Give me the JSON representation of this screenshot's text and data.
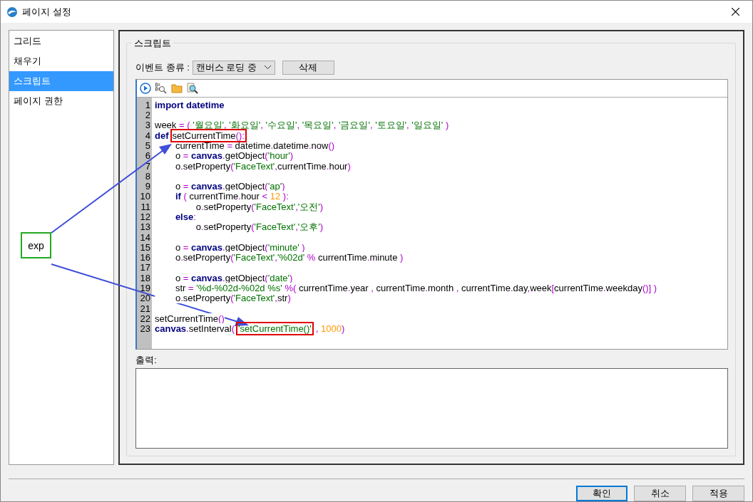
{
  "window": {
    "title": "페이지 설정"
  },
  "sidebar": {
    "items": [
      {
        "label": "그리드",
        "selected": false
      },
      {
        "label": "채우기",
        "selected": false
      },
      {
        "label": "스크립트",
        "selected": true
      },
      {
        "label": "페이지 권한",
        "selected": false
      }
    ]
  },
  "script_group": {
    "title": "스크립트",
    "event_label": "이벤트 종류 :",
    "event_select": {
      "value": "캔버스 로딩 중"
    },
    "delete_button": "삭제"
  },
  "editor": {
    "lines": [
      {
        "number": "1",
        "tokens": [
          {
            "kind": "kw",
            "text": "import datetime"
          }
        ]
      },
      {
        "number": "2"
      },
      {
        "number": "3",
        "tokens": [
          {
            "kind": "id",
            "text": "week "
          },
          {
            "kind": "op",
            "text": "= ( "
          },
          {
            "kind": "str",
            "text": "'월요일'"
          },
          {
            "kind": "op",
            "text": ", "
          },
          {
            "kind": "str",
            "text": "'화요일'"
          },
          {
            "kind": "op",
            "text": ", "
          },
          {
            "kind": "str",
            "text": "'수요일'"
          },
          {
            "kind": "op",
            "text": ", "
          },
          {
            "kind": "str",
            "text": "'목요일'"
          },
          {
            "kind": "op",
            "text": ", "
          },
          {
            "kind": "str",
            "text": "'금요일'"
          },
          {
            "kind": "op",
            "text": ", "
          },
          {
            "kind": "str",
            "text": "'토요일'"
          },
          {
            "kind": "op",
            "text": ", "
          },
          {
            "kind": "str",
            "text": "'일요일'"
          },
          {
            "kind": "op",
            "text": " )"
          }
        ]
      },
      {
        "number": "4",
        "tokens": [
          {
            "kind": "kw",
            "text": "def"
          },
          {
            "kind": "id",
            "text": "setCurrentTime",
            "boxed": true
          },
          {
            "kind": "op",
            "text": "():",
            "boxed": true
          }
        ]
      },
      {
        "number": "5",
        "tokens": [
          {
            "kind": "id",
            "text": "        currentTime "
          },
          {
            "kind": "op",
            "text": "= "
          },
          {
            "kind": "id",
            "text": "datetime"
          },
          {
            "kind": "op",
            "text": "."
          },
          {
            "kind": "id",
            "text": "datetime"
          },
          {
            "kind": "op",
            "text": "."
          },
          {
            "kind": "id",
            "text": "now"
          },
          {
            "kind": "op",
            "text": "()"
          }
        ]
      },
      {
        "number": "6",
        "tokens": [
          {
            "kind": "id",
            "text": "        o "
          },
          {
            "kind": "op",
            "text": "= "
          },
          {
            "kind": "kw",
            "text": "canvas"
          },
          {
            "kind": "op",
            "text": "."
          },
          {
            "kind": "id",
            "text": "getObject"
          },
          {
            "kind": "op",
            "text": "("
          },
          {
            "kind": "str",
            "text": "'hour'"
          },
          {
            "kind": "op",
            "text": ")"
          }
        ]
      },
      {
        "number": "7",
        "tokens": [
          {
            "kind": "id",
            "text": "        o"
          },
          {
            "kind": "op",
            "text": "."
          },
          {
            "kind": "id",
            "text": "setProperty"
          },
          {
            "kind": "op",
            "text": "("
          },
          {
            "kind": "str",
            "text": "'FaceText'"
          },
          {
            "kind": "op",
            "text": ","
          },
          {
            "kind": "id",
            "text": "currentTime"
          },
          {
            "kind": "op",
            "text": "."
          },
          {
            "kind": "id",
            "text": "hour"
          },
          {
            "kind": "op",
            "text": ")"
          }
        ]
      },
      {
        "number": "8"
      },
      {
        "number": "9",
        "tokens": [
          {
            "kind": "id",
            "text": "        o "
          },
          {
            "kind": "op",
            "text": "= "
          },
          {
            "kind": "kw",
            "text": "canvas"
          },
          {
            "kind": "op",
            "text": "."
          },
          {
            "kind": "id",
            "text": "getObject"
          },
          {
            "kind": "op",
            "text": "("
          },
          {
            "kind": "str",
            "text": "'ap'"
          },
          {
            "kind": "op",
            "text": ")"
          }
        ]
      },
      {
        "number": "10",
        "tokens": [
          {
            "kind": "kw",
            "text": "        if"
          },
          {
            "kind": "op",
            "text": " ( "
          },
          {
            "kind": "id",
            "text": "currentTime"
          },
          {
            "kind": "op",
            "text": "."
          },
          {
            "kind": "id",
            "text": "hour "
          },
          {
            "kind": "op",
            "text": "< "
          },
          {
            "kind": "num",
            "text": "12"
          },
          {
            "kind": "op",
            "text": " ):"
          }
        ]
      },
      {
        "number": "11",
        "tokens": [
          {
            "kind": "id",
            "text": "                o"
          },
          {
            "kind": "op",
            "text": "."
          },
          {
            "kind": "id",
            "text": "setProperty"
          },
          {
            "kind": "op",
            "text": "("
          },
          {
            "kind": "str",
            "text": "'FaceText'"
          },
          {
            "kind": "op",
            "text": ","
          },
          {
            "kind": "str",
            "text": "'오전'"
          },
          {
            "kind": "op",
            "text": ")"
          }
        ]
      },
      {
        "number": "12",
        "tokens": [
          {
            "kind": "kw",
            "text": "        else"
          },
          {
            "kind": "op",
            "text": ":"
          }
        ]
      },
      {
        "number": "13",
        "tokens": [
          {
            "kind": "id",
            "text": "                o"
          },
          {
            "kind": "op",
            "text": "."
          },
          {
            "kind": "id",
            "text": "setProperty"
          },
          {
            "kind": "op",
            "text": "("
          },
          {
            "kind": "str",
            "text": "'FaceText'"
          },
          {
            "kind": "op",
            "text": ","
          },
          {
            "kind": "str",
            "text": "'오후'"
          },
          {
            "kind": "op",
            "text": ")"
          }
        ]
      },
      {
        "number": "14"
      },
      {
        "number": "15",
        "tokens": [
          {
            "kind": "id",
            "text": "        o "
          },
          {
            "kind": "op",
            "text": "= "
          },
          {
            "kind": "kw",
            "text": "canvas"
          },
          {
            "kind": "op",
            "text": "."
          },
          {
            "kind": "id",
            "text": "getObject"
          },
          {
            "kind": "op",
            "text": "("
          },
          {
            "kind": "str",
            "text": "'minute' "
          },
          {
            "kind": "op",
            "text": ")"
          }
        ]
      },
      {
        "number": "16",
        "tokens": [
          {
            "kind": "id",
            "text": "        o"
          },
          {
            "kind": "op",
            "text": "."
          },
          {
            "kind": "id",
            "text": "setProperty"
          },
          {
            "kind": "op",
            "text": "("
          },
          {
            "kind": "str",
            "text": "'FaceText'"
          },
          {
            "kind": "op",
            "text": ","
          },
          {
            "kind": "str",
            "text": "'%02d' "
          },
          {
            "kind": "op",
            "text": "% "
          },
          {
            "kind": "id",
            "text": "currentTime"
          },
          {
            "kind": "op",
            "text": "."
          },
          {
            "kind": "id",
            "text": "minute "
          },
          {
            "kind": "op",
            "text": ")"
          }
        ]
      },
      {
        "number": "17"
      },
      {
        "number": "18",
        "tokens": [
          {
            "kind": "id",
            "text": "        o "
          },
          {
            "kind": "op",
            "text": "= "
          },
          {
            "kind": "kw",
            "text": "canvas"
          },
          {
            "kind": "op",
            "text": "."
          },
          {
            "kind": "id",
            "text": "getObject"
          },
          {
            "kind": "op",
            "text": "("
          },
          {
            "kind": "str",
            "text": "'date'"
          },
          {
            "kind": "op",
            "text": ")"
          }
        ]
      },
      {
        "number": "19",
        "tokens": [
          {
            "kind": "id",
            "text": "        str "
          },
          {
            "kind": "op",
            "text": "= "
          },
          {
            "kind": "str",
            "text": "'%d-%02d-%02d %s' "
          },
          {
            "kind": "op",
            "text": "%( "
          },
          {
            "kind": "id",
            "text": "currentTime"
          },
          {
            "kind": "op",
            "text": "."
          },
          {
            "kind": "id",
            "text": "year "
          },
          {
            "kind": "op",
            "text": ", "
          },
          {
            "kind": "id",
            "text": "currentTime"
          },
          {
            "kind": "op",
            "text": "."
          },
          {
            "kind": "id",
            "text": "month "
          },
          {
            "kind": "op",
            "text": ", "
          },
          {
            "kind": "id",
            "text": "currentTime"
          },
          {
            "kind": "op",
            "text": "."
          },
          {
            "kind": "id",
            "text": "day"
          },
          {
            "kind": "op",
            "text": ","
          },
          {
            "kind": "id",
            "text": "week"
          },
          {
            "kind": "op",
            "text": "["
          },
          {
            "kind": "id",
            "text": "currentTime"
          },
          {
            "kind": "op",
            "text": "."
          },
          {
            "kind": "id",
            "text": "weekday"
          },
          {
            "kind": "op",
            "text": "()] )"
          }
        ]
      },
      {
        "number": "20",
        "tokens": [
          {
            "kind": "id",
            "text": "        o"
          },
          {
            "kind": "op",
            "text": "."
          },
          {
            "kind": "id",
            "text": "setProperty"
          },
          {
            "kind": "op",
            "text": "("
          },
          {
            "kind": "str",
            "text": "'FaceText'"
          },
          {
            "kind": "op",
            "text": ","
          },
          {
            "kind": "id",
            "text": "str"
          },
          {
            "kind": "op",
            "text": ")"
          }
        ]
      },
      {
        "number": "21"
      },
      {
        "number": "22",
        "tokens": [
          {
            "kind": "id",
            "text": "setCurrentTime"
          },
          {
            "kind": "op",
            "text": "()"
          }
        ]
      },
      {
        "number": "23",
        "tokens": [
          {
            "kind": "kw",
            "text": "canvas"
          },
          {
            "kind": "op",
            "text": "."
          },
          {
            "kind": "id",
            "text": "setInterval"
          },
          {
            "kind": "op",
            "text": "("
          },
          {
            "kind": "str",
            "text": "'setCurrentTime()'",
            "boxed": true
          },
          {
            "kind": "op",
            "text": ", "
          },
          {
            "kind": "num",
            "text": "1000"
          },
          {
            "kind": "op",
            "text": ")"
          }
        ]
      }
    ]
  },
  "callout": {
    "label": "exp"
  },
  "output": {
    "label": "출력:"
  },
  "buttons": [
    {
      "label": "확인",
      "default": true
    },
    {
      "label": "취소",
      "default": false
    },
    {
      "label": "적용",
      "default": false
    }
  ]
}
